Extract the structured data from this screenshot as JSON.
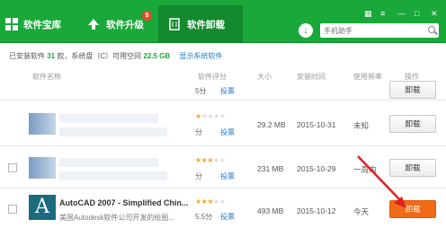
{
  "header": {
    "tabs": [
      {
        "label": "软件宝库"
      },
      {
        "label": "软件升级",
        "badge": "5"
      },
      {
        "label": "软件卸载"
      }
    ],
    "search_placeholder": "手机助手",
    "accent": "#19a839"
  },
  "summary": {
    "prefix": "已安装软件",
    "count": "31",
    "middle": "款，系统盘（C）可用空间",
    "space": "22.5 GB",
    "link": "显示系统软件"
  },
  "columns": [
    "软件名称",
    "软件评分",
    "大小",
    "安装时间",
    "使用频率",
    "操作"
  ],
  "rows": [
    {
      "score": "5分",
      "vote": "投票",
      "size": "",
      "date": "",
      "freq": "",
      "action": "卸载",
      "stars": 0
    },
    {
      "score": "分",
      "vote": "投票",
      "size": "29.2 MB",
      "date": "2015-10-31",
      "freq": "未知",
      "action": "卸载",
      "stars": 1
    },
    {
      "score": "分",
      "vote": "投票",
      "size": "231 MB",
      "date": "2015-10-29",
      "freq": "一周内",
      "action": "卸载",
      "stars": 3
    },
    {
      "name": "AutoCAD 2007 - Simplified Chin...",
      "desc": "美国Autodesk软件公司开发的绘图...",
      "score": "5.5分",
      "vote": "投票",
      "size": "493 MB",
      "date": "2015-10-12",
      "freq": "今天",
      "action": "卸载",
      "stars": 3
    }
  ]
}
